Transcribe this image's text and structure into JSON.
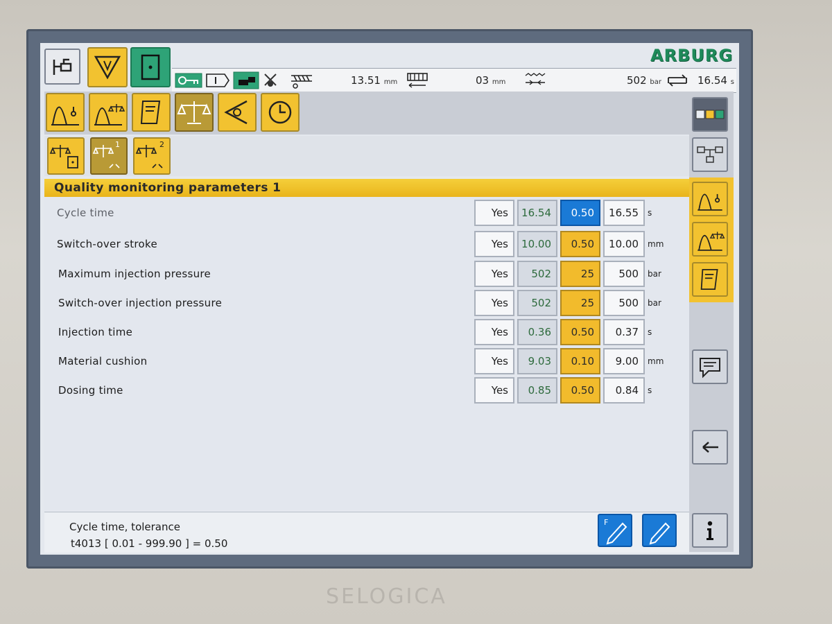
{
  "brand": "ARBURG",
  "device": "SELOGICA",
  "status_bar": {
    "screw_position": {
      "value": "13.51",
      "unit": "mm"
    },
    "mold_position": {
      "value": "03",
      "unit": "mm"
    },
    "pressure": {
      "value": "502",
      "unit": "bar"
    },
    "cycle_time": {
      "value": "16.54",
      "unit": "s"
    }
  },
  "page": {
    "title": "Quality monitoring parameters 1"
  },
  "subtabs": [
    {
      "label": ""
    },
    {
      "label": "1"
    },
    {
      "label": "2"
    }
  ],
  "parameters": [
    {
      "label": "Cycle time",
      "monitor": "Yes",
      "actual": "16.54",
      "tolerance": "0.50",
      "setpoint": "16.55",
      "unit": "s",
      "selected": true
    },
    {
      "label": "Switch-over stroke",
      "monitor": "Yes",
      "actual": "10.00",
      "tolerance": "0.50",
      "setpoint": "10.00",
      "unit": "mm",
      "selected": false
    },
    {
      "label": "Maximum injection pressure",
      "monitor": "Yes",
      "actual": "502",
      "tolerance": "25",
      "setpoint": "500",
      "unit": "bar",
      "selected": false
    },
    {
      "label": "Switch-over injection pressure",
      "monitor": "Yes",
      "actual": "502",
      "tolerance": "25",
      "setpoint": "500",
      "unit": "bar",
      "selected": false
    },
    {
      "label": "Injection time",
      "monitor": "Yes",
      "actual": "0.36",
      "tolerance": "0.50",
      "setpoint": "0.37",
      "unit": "s",
      "selected": false
    },
    {
      "label": "Material cushion",
      "monitor": "Yes",
      "actual": "9.03",
      "tolerance": "0.10",
      "setpoint": "9.00",
      "unit": "mm",
      "selected": false
    },
    {
      "label": "Dosing time",
      "monitor": "Yes",
      "actual": "0.85",
      "tolerance": "0.50",
      "setpoint": "0.84",
      "unit": "s",
      "selected": false
    }
  ],
  "info_panel": {
    "line1": "Cycle time, tolerance",
    "line2": "t4013 [ 0.01 - 999.90 ] = 0.50"
  },
  "colors": {
    "accent_yellow": "#f2c230",
    "selected_blue": "#1a7ad6",
    "active_green": "#2ea377",
    "actual_value_text": "#2d6a3c"
  }
}
